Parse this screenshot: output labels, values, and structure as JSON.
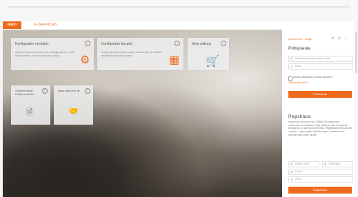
{
  "header": {
    "logo_text": "ikano",
    "nav_label": "E-SERVICES"
  },
  "tiles": [
    {
      "title": "Konfigurátor výrobkov",
      "description": "Vyberte si ľubovoľný výrobok Velux, skonfigurujte si ho podľa svojich potrieb a vložte do nákupného košíka.",
      "icon": "gears-icon",
      "info": "i"
    },
    {
      "title": "Konfigurátor bezpeč.",
      "description": "Konfigurujte bezpečnostné prvky a nakombinujte ich s ďalšími výrobkami podľa vašich potrieb.",
      "icon": "calendar-gear-icon",
      "info": "i"
    },
    {
      "title": "Moje nákupy",
      "description": "",
      "icon": "cart-icon",
      "info": "i"
    },
    {
      "title": "Overenie správ. kvality a servisu",
      "description": "",
      "icon": "document-check-icon",
      "info": "i"
    },
    {
      "title": "Ikano daily kit & tilt",
      "description": "",
      "icon": "handshake-icon",
      "info": "i"
    }
  ],
  "sidebar": {
    "language_link": "Zmena rečí / Jazyk",
    "login": {
      "title": "Prihlásenie",
      "username_placeholder": "Prihlasovacie meno alebo e-mail",
      "password_placeholder": "Heslo",
      "remember_label": "Zostať prihlásený na tomto zariadení",
      "forgot_link": "Zabudli ste heslo?",
      "submit_label": "Prihlásenie"
    },
    "registration": {
      "title": "Registrácia",
      "text": "Spoločnosť Ikano vás na E-SERVICES pozýva pre elektronickú komunikáciu. Naše služby sú vám k dispozícii kedykoľvek a z akéhokoľvek miesta. Registrácia je jednoduchá a rýchla — stačí vyplniť niekoľko údajov a môžete začať využívať naše online služby.",
      "first_name_placeholder": "Krstné meno",
      "last_name_placeholder": "Priezvisko",
      "email_placeholder": "E-mail",
      "password_placeholder": "Heslo",
      "submit_label": "Registrácia"
    }
  },
  "colors": {
    "accent": "#ee6a1c",
    "panel_background": "#ececec",
    "sidebar_background": "#ffffff"
  }
}
